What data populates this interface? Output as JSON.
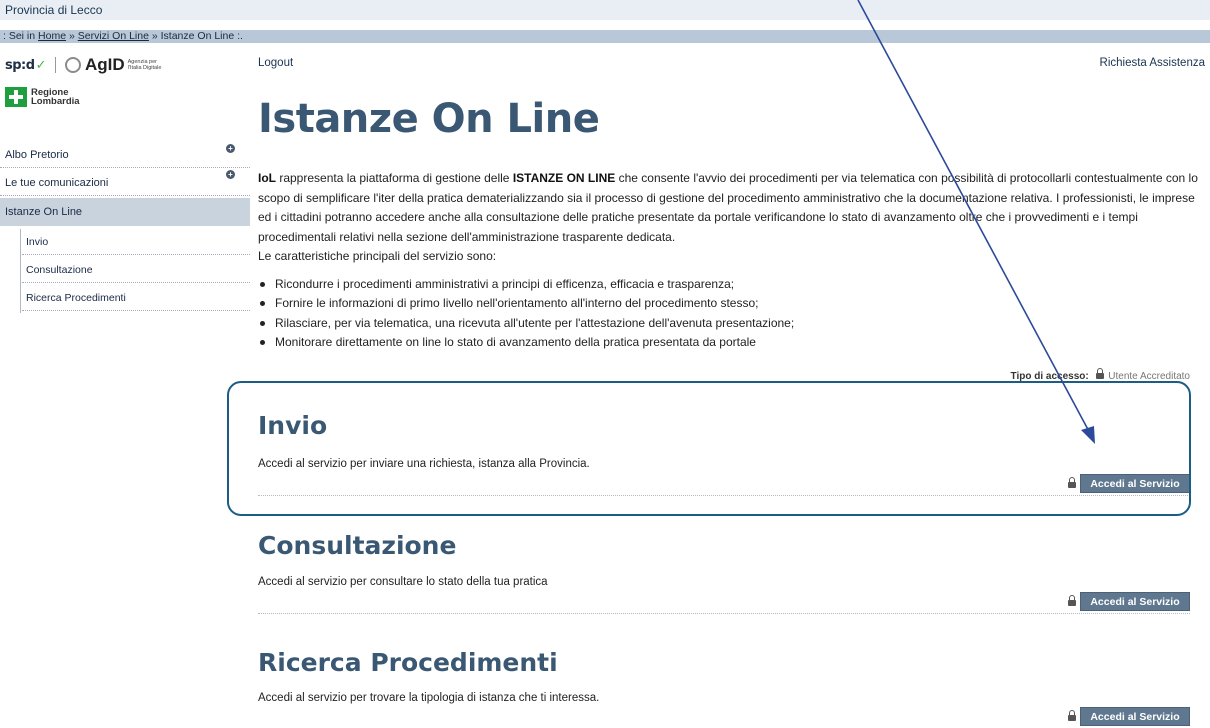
{
  "header": {
    "site_name": "Provincia di Lecco",
    "breadcrumb": {
      "prefix": ": Sei in",
      "home": "Home",
      "separator": "»",
      "servizi": "Servizi On Line",
      "current": "Istanze On Line",
      "suffix": ":."
    },
    "spid": "sp:d",
    "spid_check": "✓",
    "agid": "AgID",
    "agid_sub": "Agenzia per l'Italia Digitale",
    "regione": "Regione Lombardia",
    "logout": "Logout",
    "assistance": "Richiesta Assistenza"
  },
  "sidebar": {
    "items": [
      {
        "label": "Albo Pretorio"
      },
      {
        "label": "Le tue comunicazioni"
      },
      {
        "label": "Istanze On Line"
      }
    ],
    "subitems": [
      {
        "label": "Invio"
      },
      {
        "label": "Consultazione"
      },
      {
        "label": "Ricerca Procedimenti"
      }
    ]
  },
  "main": {
    "title": "Istanze On Line",
    "intro": {
      "lead": "IoL",
      "part1": " rappresenta la piattaforma di gestione delle ",
      "strong": "ISTANZE ON LINE",
      "part2": " che consente l'avvio dei procedimenti per via telematica con possibilità di protocollarli contestualmente con lo scopo di semplificare l'iter della pratica dematerializzando sia il processo di gestione del procedimento amministrativo che la documentazione relativa. I professionisti, le imprese ed i cittadini potranno accedere anche alla consultazione delle pratiche presentate da portale verificandone lo stato di avanzamento oltre che i provvedimenti e i tempi procedimentali relativi nella sezione dell'amministrazione trasparente dedicata.",
      "features_heading": "Le caratteristiche principali del servizio sono:"
    },
    "features": [
      "Ricondurre i procedimenti amministrativi a principi di efficenza, efficacia e trasparenza;",
      "Fornire le informazioni di primo livello nell'orientamento all'interno del procedimento stesso;",
      "Rilasciare, per via telematica, una ricevuta all'utente per l'attestazione dell'avenuta presentazione;",
      "Monitorare direttamente on line lo stato di avanzamento della pratica presentata da portale"
    ],
    "access_type": {
      "label": "Tipo di accesso:",
      "value": "Utente Accreditato"
    },
    "services": [
      {
        "title": "Invio",
        "description": "Accedi al servizio per inviare una richiesta, istanza alla Provincia.",
        "button": "Accedi al Servizio"
      },
      {
        "title": "Consultazione",
        "description": "Accedi al servizio per consultare lo stato della tua pratica",
        "button": "Accedi al Servizio"
      },
      {
        "title": "Ricerca Procedimenti",
        "description": "Accedi al servizio per trovare la tipologia di istanza che ti interessa.",
        "button": "Accedi al Servizio"
      }
    ]
  },
  "colors": {
    "title_blue": "#3a5873",
    "button_blue": "#5f7890",
    "highlight": "#1a5d86",
    "arrow": "#2b4a9a"
  }
}
